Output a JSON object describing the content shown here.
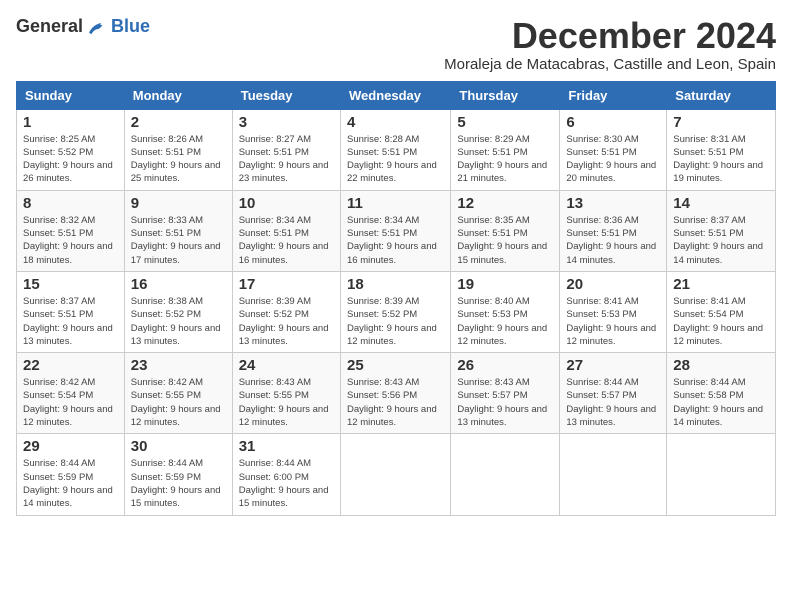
{
  "header": {
    "logo_general": "General",
    "logo_blue": "Blue",
    "title": "December 2024",
    "subtitle": "Moraleja de Matacabras, Castille and Leon, Spain"
  },
  "columns": [
    "Sunday",
    "Monday",
    "Tuesday",
    "Wednesday",
    "Thursday",
    "Friday",
    "Saturday"
  ],
  "weeks": [
    [
      {
        "day": "1",
        "sunrise": "Sunrise: 8:25 AM",
        "sunset": "Sunset: 5:52 PM",
        "daylight": "Daylight: 9 hours and 26 minutes."
      },
      {
        "day": "2",
        "sunrise": "Sunrise: 8:26 AM",
        "sunset": "Sunset: 5:51 PM",
        "daylight": "Daylight: 9 hours and 25 minutes."
      },
      {
        "day": "3",
        "sunrise": "Sunrise: 8:27 AM",
        "sunset": "Sunset: 5:51 PM",
        "daylight": "Daylight: 9 hours and 23 minutes."
      },
      {
        "day": "4",
        "sunrise": "Sunrise: 8:28 AM",
        "sunset": "Sunset: 5:51 PM",
        "daylight": "Daylight: 9 hours and 22 minutes."
      },
      {
        "day": "5",
        "sunrise": "Sunrise: 8:29 AM",
        "sunset": "Sunset: 5:51 PM",
        "daylight": "Daylight: 9 hours and 21 minutes."
      },
      {
        "day": "6",
        "sunrise": "Sunrise: 8:30 AM",
        "sunset": "Sunset: 5:51 PM",
        "daylight": "Daylight: 9 hours and 20 minutes."
      },
      {
        "day": "7",
        "sunrise": "Sunrise: 8:31 AM",
        "sunset": "Sunset: 5:51 PM",
        "daylight": "Daylight: 9 hours and 19 minutes."
      }
    ],
    [
      {
        "day": "8",
        "sunrise": "Sunrise: 8:32 AM",
        "sunset": "Sunset: 5:51 PM",
        "daylight": "Daylight: 9 hours and 18 minutes."
      },
      {
        "day": "9",
        "sunrise": "Sunrise: 8:33 AM",
        "sunset": "Sunset: 5:51 PM",
        "daylight": "Daylight: 9 hours and 17 minutes."
      },
      {
        "day": "10",
        "sunrise": "Sunrise: 8:34 AM",
        "sunset": "Sunset: 5:51 PM",
        "daylight": "Daylight: 9 hours and 16 minutes."
      },
      {
        "day": "11",
        "sunrise": "Sunrise: 8:34 AM",
        "sunset": "Sunset: 5:51 PM",
        "daylight": "Daylight: 9 hours and 16 minutes."
      },
      {
        "day": "12",
        "sunrise": "Sunrise: 8:35 AM",
        "sunset": "Sunset: 5:51 PM",
        "daylight": "Daylight: 9 hours and 15 minutes."
      },
      {
        "day": "13",
        "sunrise": "Sunrise: 8:36 AM",
        "sunset": "Sunset: 5:51 PM",
        "daylight": "Daylight: 9 hours and 14 minutes."
      },
      {
        "day": "14",
        "sunrise": "Sunrise: 8:37 AM",
        "sunset": "Sunset: 5:51 PM",
        "daylight": "Daylight: 9 hours and 14 minutes."
      }
    ],
    [
      {
        "day": "15",
        "sunrise": "Sunrise: 8:37 AM",
        "sunset": "Sunset: 5:51 PM",
        "daylight": "Daylight: 9 hours and 13 minutes."
      },
      {
        "day": "16",
        "sunrise": "Sunrise: 8:38 AM",
        "sunset": "Sunset: 5:52 PM",
        "daylight": "Daylight: 9 hours and 13 minutes."
      },
      {
        "day": "17",
        "sunrise": "Sunrise: 8:39 AM",
        "sunset": "Sunset: 5:52 PM",
        "daylight": "Daylight: 9 hours and 13 minutes."
      },
      {
        "day": "18",
        "sunrise": "Sunrise: 8:39 AM",
        "sunset": "Sunset: 5:52 PM",
        "daylight": "Daylight: 9 hours and 12 minutes."
      },
      {
        "day": "19",
        "sunrise": "Sunrise: 8:40 AM",
        "sunset": "Sunset: 5:53 PM",
        "daylight": "Daylight: 9 hours and 12 minutes."
      },
      {
        "day": "20",
        "sunrise": "Sunrise: 8:41 AM",
        "sunset": "Sunset: 5:53 PM",
        "daylight": "Daylight: 9 hours and 12 minutes."
      },
      {
        "day": "21",
        "sunrise": "Sunrise: 8:41 AM",
        "sunset": "Sunset: 5:54 PM",
        "daylight": "Daylight: 9 hours and 12 minutes."
      }
    ],
    [
      {
        "day": "22",
        "sunrise": "Sunrise: 8:42 AM",
        "sunset": "Sunset: 5:54 PM",
        "daylight": "Daylight: 9 hours and 12 minutes."
      },
      {
        "day": "23",
        "sunrise": "Sunrise: 8:42 AM",
        "sunset": "Sunset: 5:55 PM",
        "daylight": "Daylight: 9 hours and 12 minutes."
      },
      {
        "day": "24",
        "sunrise": "Sunrise: 8:43 AM",
        "sunset": "Sunset: 5:55 PM",
        "daylight": "Daylight: 9 hours and 12 minutes."
      },
      {
        "day": "25",
        "sunrise": "Sunrise: 8:43 AM",
        "sunset": "Sunset: 5:56 PM",
        "daylight": "Daylight: 9 hours and 12 minutes."
      },
      {
        "day": "26",
        "sunrise": "Sunrise: 8:43 AM",
        "sunset": "Sunset: 5:57 PM",
        "daylight": "Daylight: 9 hours and 13 minutes."
      },
      {
        "day": "27",
        "sunrise": "Sunrise: 8:44 AM",
        "sunset": "Sunset: 5:57 PM",
        "daylight": "Daylight: 9 hours and 13 minutes."
      },
      {
        "day": "28",
        "sunrise": "Sunrise: 8:44 AM",
        "sunset": "Sunset: 5:58 PM",
        "daylight": "Daylight: 9 hours and 14 minutes."
      }
    ],
    [
      {
        "day": "29",
        "sunrise": "Sunrise: 8:44 AM",
        "sunset": "Sunset: 5:59 PM",
        "daylight": "Daylight: 9 hours and 14 minutes."
      },
      {
        "day": "30",
        "sunrise": "Sunrise: 8:44 AM",
        "sunset": "Sunset: 5:59 PM",
        "daylight": "Daylight: 9 hours and 15 minutes."
      },
      {
        "day": "31",
        "sunrise": "Sunrise: 8:44 AM",
        "sunset": "Sunset: 6:00 PM",
        "daylight": "Daylight: 9 hours and 15 minutes."
      },
      null,
      null,
      null,
      null
    ]
  ]
}
